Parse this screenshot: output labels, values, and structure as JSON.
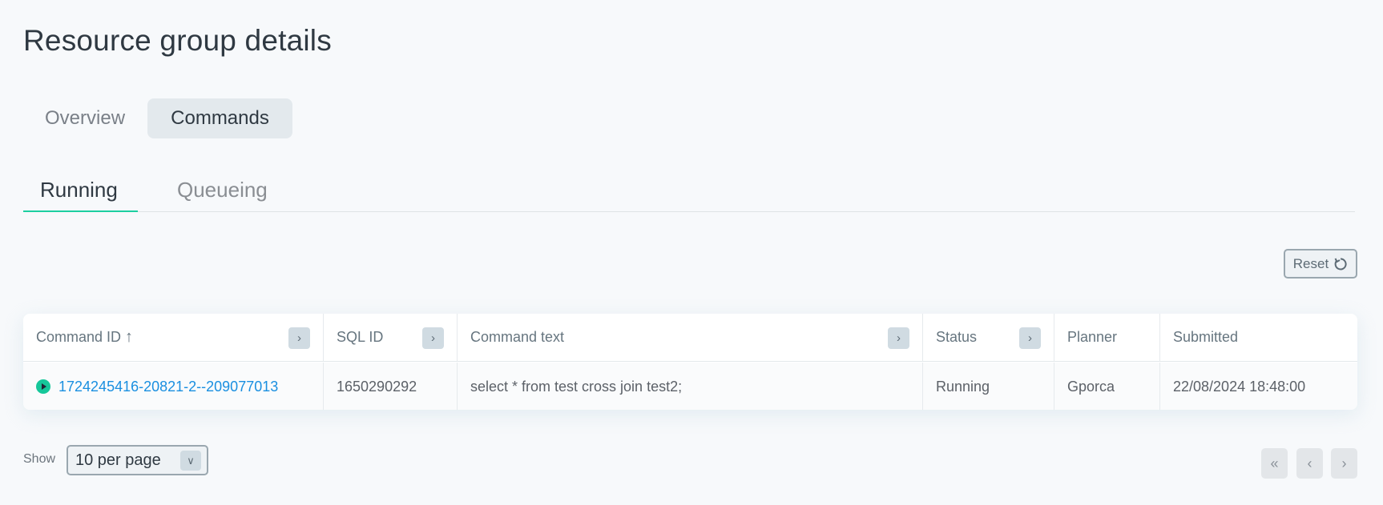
{
  "page": {
    "title": "Resource group details"
  },
  "tabs": [
    {
      "label": "Overview",
      "active": false
    },
    {
      "label": "Commands",
      "active": true
    }
  ],
  "subtabs": [
    {
      "label": "Running",
      "active": true
    },
    {
      "label": "Queueing",
      "active": false
    }
  ],
  "accent_color": "#1ccfa0",
  "toolbar": {
    "reset_label": "Reset",
    "reset_icon": "refresh-icon"
  },
  "table": {
    "columns": [
      {
        "label": "Command ID",
        "sort": "ascending",
        "expandable": true
      },
      {
        "label": "SQL ID",
        "expandable": true
      },
      {
        "label": "Command text",
        "expandable": true
      },
      {
        "label": "Status",
        "expandable": true
      },
      {
        "label": "Planner",
        "expandable": false
      },
      {
        "label": "Submitted",
        "expandable": false
      }
    ],
    "rows": [
      {
        "command_id": "1724245416-20821-2--209077013",
        "status_icon": "running-icon",
        "sql_id": "1650290292",
        "command_text": "select * from test cross join test2;",
        "status": "Running",
        "planner": "Gporca",
        "submitted": "22/08/2024 18:48:00"
      }
    ]
  },
  "footer": {
    "show_label": "Show",
    "page_size": "10 per page"
  },
  "icons": {
    "sort": "↑",
    "expand": "›",
    "chevron": "⌄",
    "first": "«",
    "prev": "‹",
    "next": "›"
  }
}
